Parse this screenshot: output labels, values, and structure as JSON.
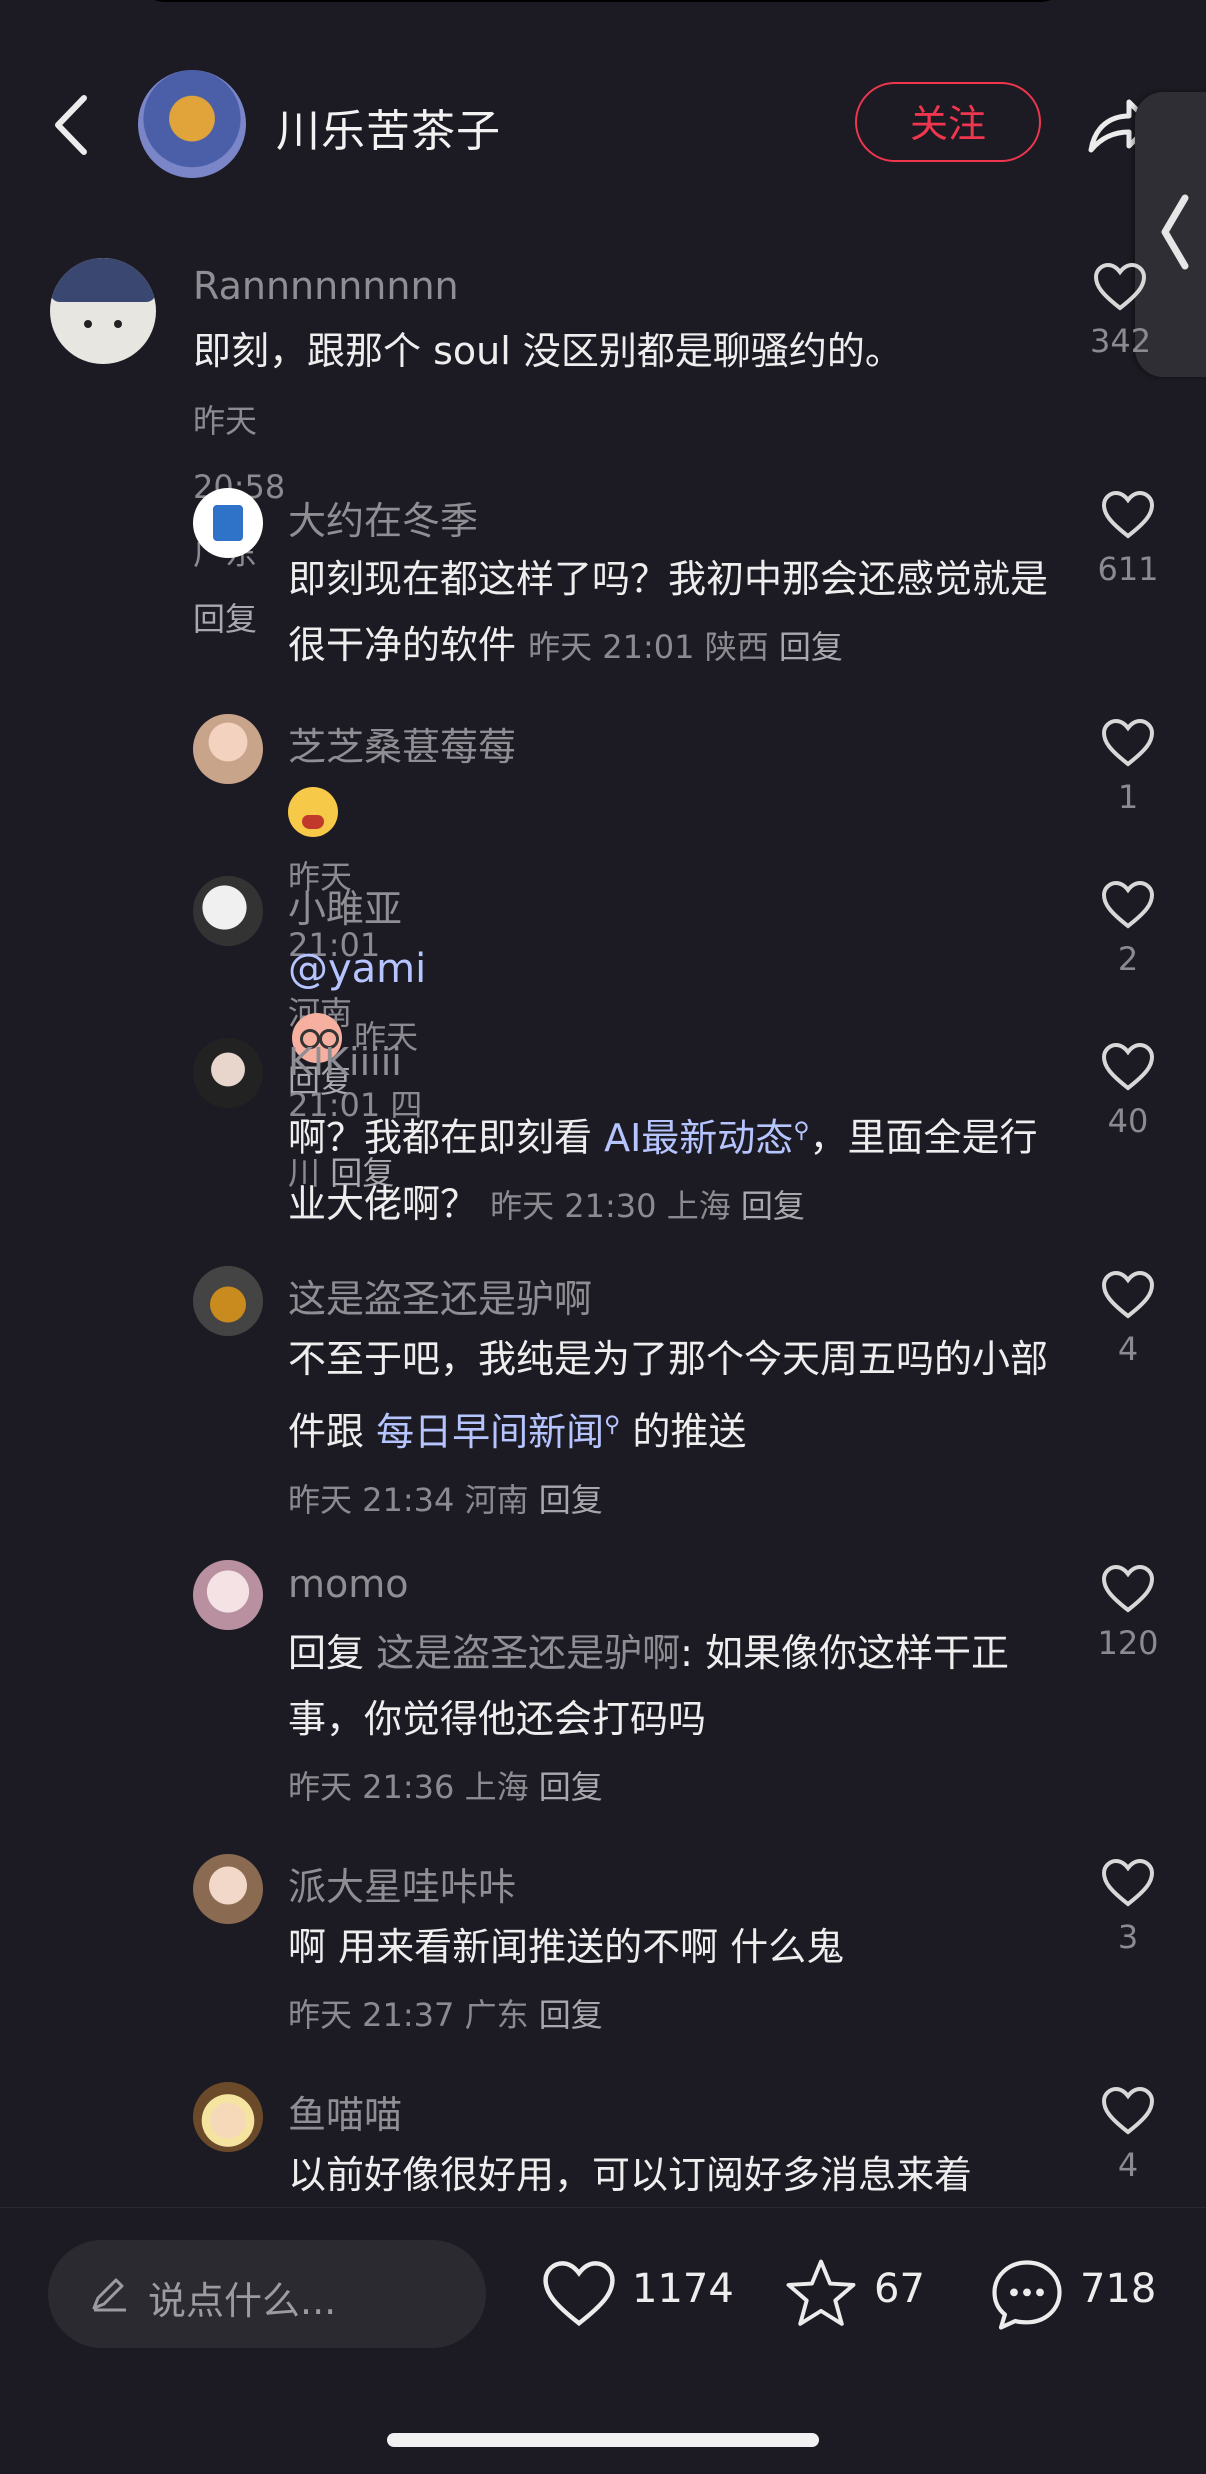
{
  "header": {
    "author_name": "川乐苦茶子",
    "follow_label": "关注"
  },
  "comments": [
    {
      "name": "Rannnnnnnnn",
      "text": "即刻，跟那个 soul 没区别都是聊骚约的。",
      "time": "昨天 20:58",
      "location": "广东",
      "reply": "回复",
      "likes": "342"
    },
    {
      "name": "大约在冬季",
      "text": "即刻现在都这样了吗？我初中那会还感觉就是很干净的软件",
      "time": "昨天 21:01",
      "location": "陕西",
      "reply": "回复",
      "likes": "611"
    },
    {
      "name": "芝芝桑葚莓莓",
      "text": "",
      "time": "昨天 21:01",
      "location": "河南",
      "reply": "回复",
      "likes": "1"
    },
    {
      "name": "小雎亚",
      "mention": "@yami",
      "time": "昨天 21:01",
      "location": "四川",
      "reply": "回复",
      "likes": "2"
    },
    {
      "name": "KIKiiiii",
      "text_a": "啊？我都在即刻看",
      "link": "AI最新动态",
      "text_b": "，里面全是行业大佬啊？",
      "time": "昨天 21:30",
      "location": "上海",
      "reply": "回复",
      "likes": "40"
    },
    {
      "name": "这是盗圣还是驴啊",
      "text_a": "不至于吧，我纯是为了那个今天周五吗的小部件跟",
      "link": "每日早间新闻",
      "text_b": "的推送",
      "time": "昨天 21:34",
      "location": "河南",
      "reply": "回复",
      "likes": "4"
    },
    {
      "name": "momo",
      "reply_prefix": "回复",
      "reply_to": "这是盗圣还是驴啊",
      "text": ": 如果像你这样干正事，你觉得他还会打码吗",
      "time": "昨天 21:36",
      "location": "上海",
      "reply": "回复",
      "likes": "120"
    },
    {
      "name": "派大星哇咔咔",
      "text": "啊 用来看新闻推送的不啊 什么鬼",
      "time": "昨天 21:37",
      "location": "广东",
      "reply": "回复",
      "likes": "3"
    },
    {
      "name": "鱼喵喵",
      "text": "以前好像很好用，可以订阅好多消息来着",
      "likes": "4"
    }
  ],
  "bottom": {
    "placeholder": "说点什么...",
    "likes": "1174",
    "stars": "67",
    "comments": "718"
  },
  "colors": {
    "accent": "#f0364f",
    "background": "#1c1b23",
    "link": "#b6c4ff"
  }
}
